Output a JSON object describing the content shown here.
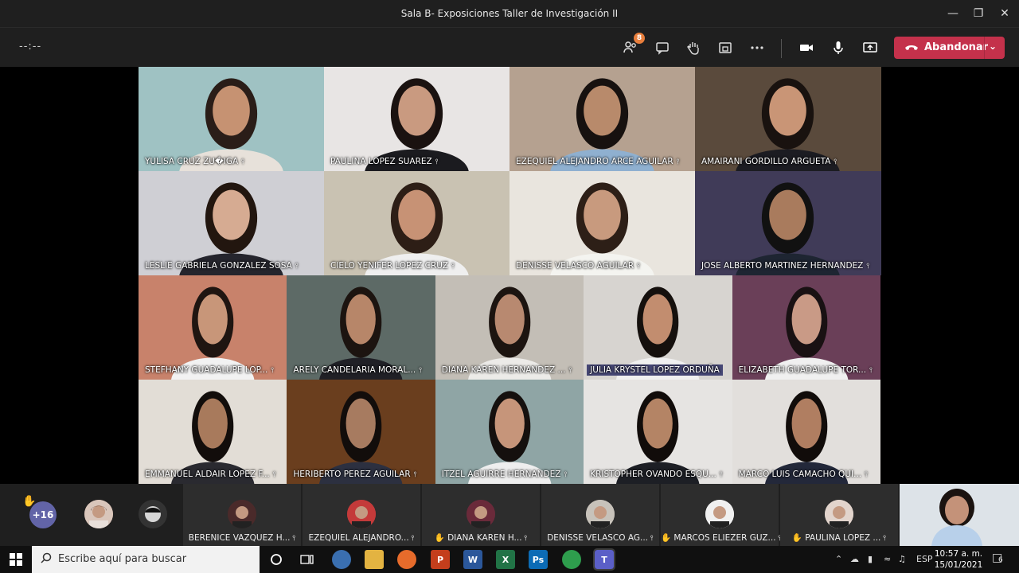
{
  "window": {
    "title": "Sala B- Exposiciones Taller de Investigación II"
  },
  "toolbar": {
    "timer": "--:--",
    "participants_badge": "8",
    "leave_label": "Abandonar"
  },
  "tiles": [
    {
      "name": "YULISA CRUZ ZU�IGA",
      "bg": "#9fc2c3",
      "shirt": "#e7e1da",
      "hair": "#2a1d18",
      "skin": "#c69272",
      "highlight": false
    },
    {
      "name": "PAULINA LOPEZ SUAREZ",
      "bg": "#e8e5e4",
      "shirt": "#1b1b1f",
      "hair": "#1a1210",
      "skin": "#c99a80",
      "highlight": false
    },
    {
      "name": "EZEQUIEL ALEJANDRO ARCE AGUILAR",
      "bg": "#b5a190",
      "shirt": "#8fb0d0",
      "hair": "#17110f",
      "skin": "#b88a6b",
      "highlight": false
    },
    {
      "name": "AMAIRANI GORDILLO ARGUETA",
      "bg": "#5a4a3c",
      "shirt": "#1c1c22",
      "hair": "#19120f",
      "skin": "#c99576",
      "highlight": false
    },
    {
      "name": "LESLIE GABRIELA GONZALEZ SOSA",
      "bg": "#cfcfd4",
      "shirt": "#25252d",
      "hair": "#22160f",
      "skin": "#d6ab92",
      "highlight": false
    },
    {
      "name": "CIELO YENIFER LOPEZ CRUZ",
      "bg": "#c9c2b2",
      "shirt": "#efefef",
      "hair": "#2d1e16",
      "skin": "#c79275",
      "highlight": false
    },
    {
      "name": "DENISSE VELASCO AGUILAR",
      "bg": "#e9e5de",
      "shirt": "#f4f4f0",
      "hair": "#2d1f17",
      "skin": "#c89a7e",
      "highlight": false
    },
    {
      "name": "JOSE ALBERTO MARTINEZ HERNANDEZ",
      "bg": "#403b58",
      "shirt": "#1e2532",
      "hair": "#111",
      "skin": "#a97b5d",
      "highlight": false
    },
    {
      "name": "STEFHANY GUADALUPE LOP...",
      "bg": "#c8826b",
      "shirt": "#f2f2f2",
      "hair": "#1f1511",
      "skin": "#c89679",
      "highlight": false
    },
    {
      "name": "ARELY CANDELARIA MORAL...",
      "bg": "#5d6a66",
      "shirt": "#202026",
      "hair": "#1c1410",
      "skin": "#b78669",
      "highlight": false
    },
    {
      "name": "DIANA KAREN HERNANDEZ ...",
      "bg": "#c3beb6",
      "shirt": "#ecebe8",
      "hair": "#1c1410",
      "skin": "#b88970",
      "highlight": false
    },
    {
      "name": "JULIA KRYSTEL LOPEZ ORDUÑA",
      "bg": "#d7d4d0",
      "shirt": "#f0f0f0",
      "hair": "#15100d",
      "skin": "#c28d6f",
      "highlight": true
    },
    {
      "name": "ELIZABETH GUADALUPE TOR...",
      "bg": "#6a3f58",
      "shirt": "#f0f0f0",
      "hair": "#191113",
      "skin": "#c99a86",
      "highlight": false
    },
    {
      "name": "EMMANUEL ALDAIR LOPEZ F...",
      "bg": "#e2ddd6",
      "shirt": "#2a2a30",
      "hair": "#120d0b",
      "skin": "#a87a5c",
      "highlight": false
    },
    {
      "name": "HERIBERTO PEREZ AGUILAR",
      "bg": "#6a3e1e",
      "shirt": "#2c3040",
      "hair": "#120d0b",
      "skin": "#a77b60",
      "highlight": false
    },
    {
      "name": "ITZEL AGUIRRE HERNANDEZ",
      "bg": "#8fa5a5",
      "shirt": "#eeeeee",
      "hair": "#15100e",
      "skin": "#c6957a",
      "highlight": false
    },
    {
      "name": "KRISTOPHER OVANDO ESQU...",
      "bg": "#e6e4e2",
      "shirt": "#1d1f25",
      "hair": "#110c0a",
      "skin": "#b48465",
      "highlight": false
    },
    {
      "name": "MARCO LUIS CAMACHO QUI...",
      "bg": "#e2dfdc",
      "shirt": "#23283a",
      "hair": "#110c0a",
      "skin": "#b07e61",
      "highlight": false
    }
  ],
  "strip": {
    "more_count": "+16",
    "members": [
      {
        "label": "BERENICE VAZQUEZ H...",
        "hand": false
      },
      {
        "label": "EZEQUIEL ALEJANDRO...",
        "hand": false
      },
      {
        "label": "DIANA KAREN H...",
        "hand": true
      },
      {
        "label": "DENISSE VELASCO AG...",
        "hand": false
      },
      {
        "label": "MARCOS ELIEZER GUZ...",
        "hand": true
      },
      {
        "label": "PAULINA LOPEZ ...",
        "hand": true
      }
    ]
  },
  "taskbar": {
    "search_placeholder": "Escribe aquí para buscar",
    "lang": "ESP",
    "time": "10:57 a. m.",
    "date": "15/01/2021",
    "notifications": "6"
  },
  "colors": {
    "accent": "#6264a7",
    "leave": "#c4314b",
    "badge": "#e87e3c"
  }
}
